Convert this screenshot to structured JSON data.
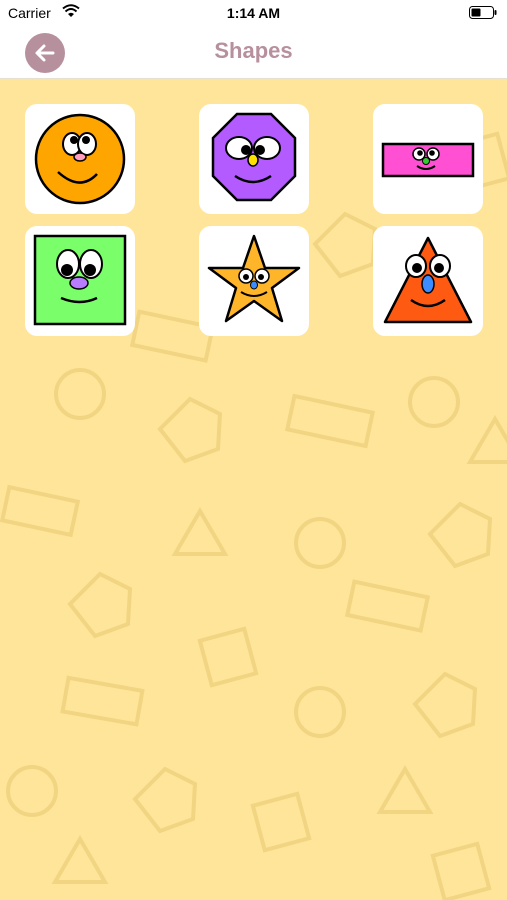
{
  "status_bar": {
    "carrier": "Carrier",
    "time": "1:14 AM"
  },
  "nav": {
    "title": "Shapes",
    "back_icon": "arrow-left-icon"
  },
  "colors": {
    "accent": "#b7909d",
    "background": "#ffe59a",
    "pattern_stroke": "#f1d582"
  },
  "shapes": [
    {
      "name": "circle",
      "color": "#ffa500"
    },
    {
      "name": "octagon",
      "color": "#b35bff"
    },
    {
      "name": "rectangle",
      "color": "#ff4fd3"
    },
    {
      "name": "square",
      "color": "#7aff6a"
    },
    {
      "name": "star",
      "color": "#ffb52a"
    },
    {
      "name": "triangle",
      "color": "#ff5a12"
    }
  ]
}
